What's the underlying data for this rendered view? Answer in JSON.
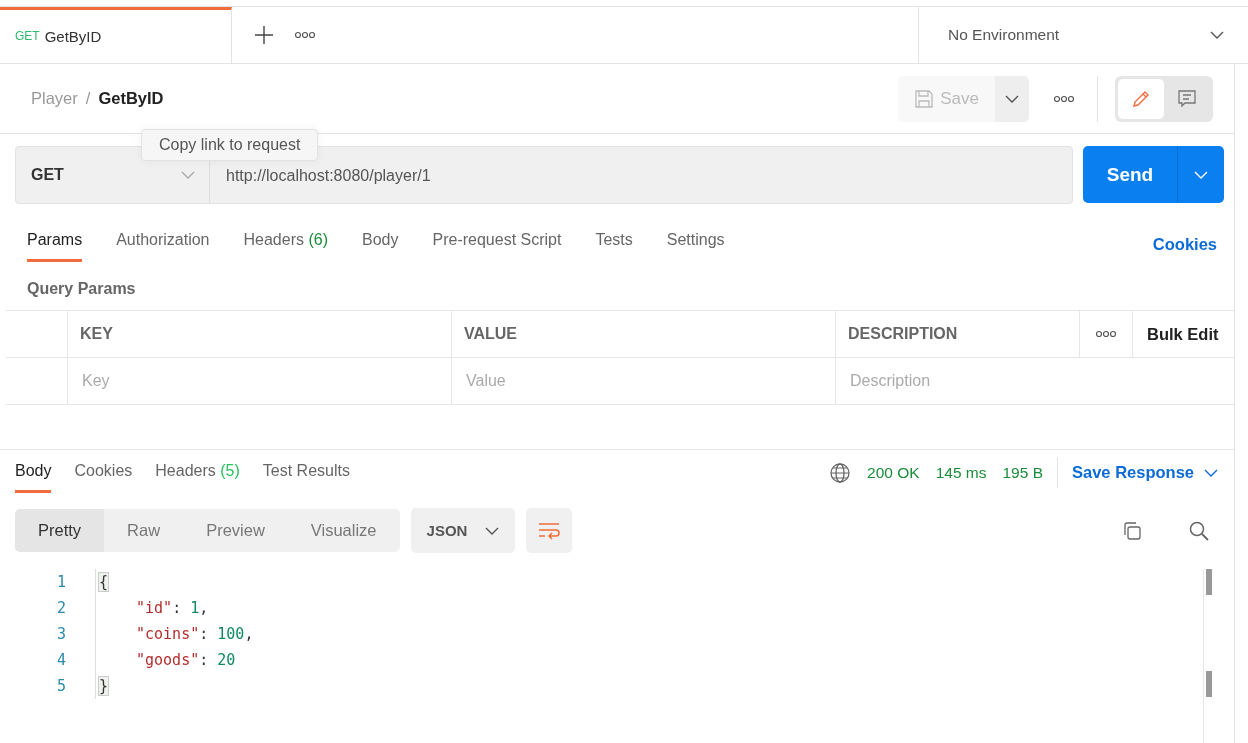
{
  "tabs": [
    {
      "method": "GET",
      "label": "GetByID",
      "selected": true
    }
  ],
  "environment": {
    "value": "No Environment"
  },
  "breadcrumb": {
    "parent": "Player",
    "separator": "/",
    "current": "GetByID"
  },
  "save_button": {
    "label": "Save",
    "disabled": true
  },
  "mode_toggle": {
    "edit_selected": true
  },
  "tooltip": "Copy link to request",
  "request": {
    "method": "GET",
    "url": "http://localhost:8080/player/1",
    "send": "Send"
  },
  "request_tabs": [
    {
      "label": "Params",
      "selected": true
    },
    {
      "label": "Authorization",
      "selected": false
    },
    {
      "label": "Headers",
      "count": "(6)",
      "selected": false
    },
    {
      "label": "Body",
      "selected": false
    },
    {
      "label": "Pre-request Script",
      "selected": false
    },
    {
      "label": "Tests",
      "selected": false
    },
    {
      "label": "Settings",
      "selected": false
    }
  ],
  "cookies_link": "Cookies",
  "query_params": {
    "title": "Query Params",
    "columns": [
      "KEY",
      "VALUE",
      "DESCRIPTION"
    ],
    "bulk_edit": "Bulk Edit",
    "placeholders": [
      "Key",
      "Value",
      "Description"
    ]
  },
  "response_tabs": [
    {
      "label": "Body",
      "selected": true
    },
    {
      "label": "Cookies",
      "selected": false
    },
    {
      "label": "Headers",
      "count": "(5)",
      "selected": false
    },
    {
      "label": "Test Results",
      "selected": false
    }
  ],
  "response_meta": {
    "status": "200 OK",
    "time": "145 ms",
    "size": "195 B",
    "save_response": "Save Response"
  },
  "view_modes": [
    {
      "label": "Pretty",
      "selected": true
    },
    {
      "label": "Raw",
      "selected": false
    },
    {
      "label": "Preview",
      "selected": false
    },
    {
      "label": "Visualize",
      "selected": false
    }
  ],
  "format": "JSON",
  "code_lines": [
    {
      "number": "1",
      "tokens": [
        {
          "kind": "brace",
          "text": "{"
        }
      ]
    },
    {
      "number": "2",
      "tokens": [
        {
          "kind": "key",
          "text": "\"id\""
        },
        {
          "kind": "punct",
          "text": ": "
        },
        {
          "kind": "number",
          "text": "1"
        },
        {
          "kind": "punct",
          "text": ","
        }
      ]
    },
    {
      "number": "3",
      "tokens": [
        {
          "kind": "key",
          "text": "\"coins\""
        },
        {
          "kind": "punct",
          "text": ": "
        },
        {
          "kind": "number",
          "text": "100"
        },
        {
          "kind": "punct",
          "text": ","
        }
      ]
    },
    {
      "number": "4",
      "tokens": [
        {
          "kind": "key",
          "text": "\"goods\""
        },
        {
          "kind": "punct",
          "text": ": "
        },
        {
          "kind": "number",
          "text": "20"
        }
      ]
    },
    {
      "number": "5",
      "tokens": [
        {
          "kind": "brace",
          "text": "}"
        }
      ]
    }
  ]
}
